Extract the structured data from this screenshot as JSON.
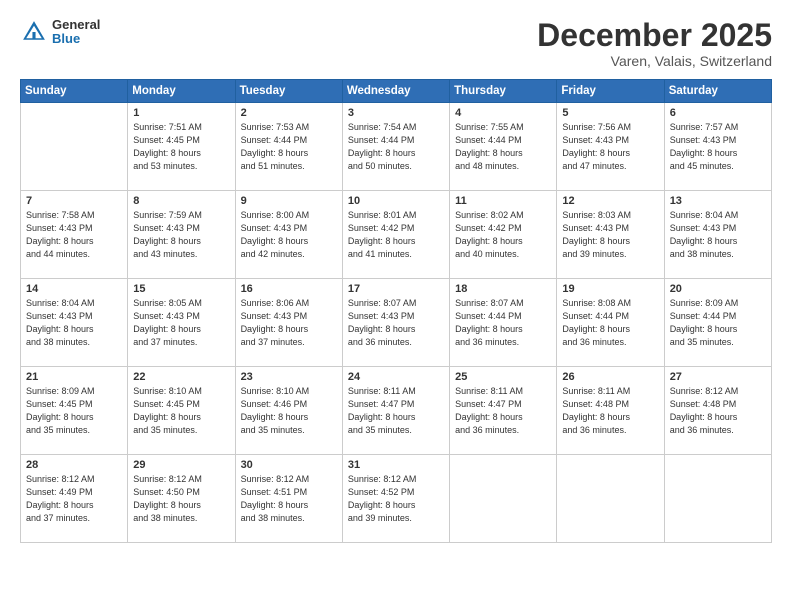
{
  "header": {
    "logo_general": "General",
    "logo_blue": "Blue",
    "main_title": "December 2025",
    "sub_title": "Varen, Valais, Switzerland"
  },
  "calendar": {
    "days_of_week": [
      "Sunday",
      "Monday",
      "Tuesday",
      "Wednesday",
      "Thursday",
      "Friday",
      "Saturday"
    ],
    "weeks": [
      [
        {
          "day": "",
          "info": ""
        },
        {
          "day": "1",
          "info": "Sunrise: 7:51 AM\nSunset: 4:45 PM\nDaylight: 8 hours\nand 53 minutes."
        },
        {
          "day": "2",
          "info": "Sunrise: 7:53 AM\nSunset: 4:44 PM\nDaylight: 8 hours\nand 51 minutes."
        },
        {
          "day": "3",
          "info": "Sunrise: 7:54 AM\nSunset: 4:44 PM\nDaylight: 8 hours\nand 50 minutes."
        },
        {
          "day": "4",
          "info": "Sunrise: 7:55 AM\nSunset: 4:44 PM\nDaylight: 8 hours\nand 48 minutes."
        },
        {
          "day": "5",
          "info": "Sunrise: 7:56 AM\nSunset: 4:43 PM\nDaylight: 8 hours\nand 47 minutes."
        },
        {
          "day": "6",
          "info": "Sunrise: 7:57 AM\nSunset: 4:43 PM\nDaylight: 8 hours\nand 45 minutes."
        }
      ],
      [
        {
          "day": "7",
          "info": "Sunrise: 7:58 AM\nSunset: 4:43 PM\nDaylight: 8 hours\nand 44 minutes."
        },
        {
          "day": "8",
          "info": "Sunrise: 7:59 AM\nSunset: 4:43 PM\nDaylight: 8 hours\nand 43 minutes."
        },
        {
          "day": "9",
          "info": "Sunrise: 8:00 AM\nSunset: 4:43 PM\nDaylight: 8 hours\nand 42 minutes."
        },
        {
          "day": "10",
          "info": "Sunrise: 8:01 AM\nSunset: 4:42 PM\nDaylight: 8 hours\nand 41 minutes."
        },
        {
          "day": "11",
          "info": "Sunrise: 8:02 AM\nSunset: 4:42 PM\nDaylight: 8 hours\nand 40 minutes."
        },
        {
          "day": "12",
          "info": "Sunrise: 8:03 AM\nSunset: 4:43 PM\nDaylight: 8 hours\nand 39 minutes."
        },
        {
          "day": "13",
          "info": "Sunrise: 8:04 AM\nSunset: 4:43 PM\nDaylight: 8 hours\nand 38 minutes."
        }
      ],
      [
        {
          "day": "14",
          "info": "Sunrise: 8:04 AM\nSunset: 4:43 PM\nDaylight: 8 hours\nand 38 minutes."
        },
        {
          "day": "15",
          "info": "Sunrise: 8:05 AM\nSunset: 4:43 PM\nDaylight: 8 hours\nand 37 minutes."
        },
        {
          "day": "16",
          "info": "Sunrise: 8:06 AM\nSunset: 4:43 PM\nDaylight: 8 hours\nand 37 minutes."
        },
        {
          "day": "17",
          "info": "Sunrise: 8:07 AM\nSunset: 4:43 PM\nDaylight: 8 hours\nand 36 minutes."
        },
        {
          "day": "18",
          "info": "Sunrise: 8:07 AM\nSunset: 4:44 PM\nDaylight: 8 hours\nand 36 minutes."
        },
        {
          "day": "19",
          "info": "Sunrise: 8:08 AM\nSunset: 4:44 PM\nDaylight: 8 hours\nand 36 minutes."
        },
        {
          "day": "20",
          "info": "Sunrise: 8:09 AM\nSunset: 4:44 PM\nDaylight: 8 hours\nand 35 minutes."
        }
      ],
      [
        {
          "day": "21",
          "info": "Sunrise: 8:09 AM\nSunset: 4:45 PM\nDaylight: 8 hours\nand 35 minutes."
        },
        {
          "day": "22",
          "info": "Sunrise: 8:10 AM\nSunset: 4:45 PM\nDaylight: 8 hours\nand 35 minutes."
        },
        {
          "day": "23",
          "info": "Sunrise: 8:10 AM\nSunset: 4:46 PM\nDaylight: 8 hours\nand 35 minutes."
        },
        {
          "day": "24",
          "info": "Sunrise: 8:11 AM\nSunset: 4:47 PM\nDaylight: 8 hours\nand 35 minutes."
        },
        {
          "day": "25",
          "info": "Sunrise: 8:11 AM\nSunset: 4:47 PM\nDaylight: 8 hours\nand 36 minutes."
        },
        {
          "day": "26",
          "info": "Sunrise: 8:11 AM\nSunset: 4:48 PM\nDaylight: 8 hours\nand 36 minutes."
        },
        {
          "day": "27",
          "info": "Sunrise: 8:12 AM\nSunset: 4:48 PM\nDaylight: 8 hours\nand 36 minutes."
        }
      ],
      [
        {
          "day": "28",
          "info": "Sunrise: 8:12 AM\nSunset: 4:49 PM\nDaylight: 8 hours\nand 37 minutes."
        },
        {
          "day": "29",
          "info": "Sunrise: 8:12 AM\nSunset: 4:50 PM\nDaylight: 8 hours\nand 38 minutes."
        },
        {
          "day": "30",
          "info": "Sunrise: 8:12 AM\nSunset: 4:51 PM\nDaylight: 8 hours\nand 38 minutes."
        },
        {
          "day": "31",
          "info": "Sunrise: 8:12 AM\nSunset: 4:52 PM\nDaylight: 8 hours\nand 39 minutes."
        },
        {
          "day": "",
          "info": ""
        },
        {
          "day": "",
          "info": ""
        },
        {
          "day": "",
          "info": ""
        }
      ]
    ]
  }
}
